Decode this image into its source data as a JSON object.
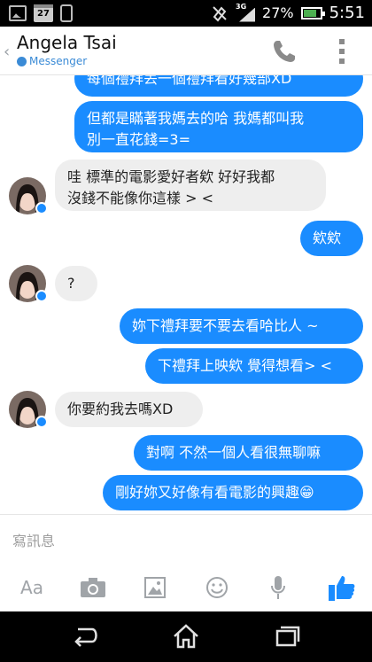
{
  "status_bar": {
    "calendar_day": "27",
    "network": "3G",
    "battery_percent": "27%",
    "time": "5:51"
  },
  "header": {
    "contact_name": "Angela Tsai",
    "subtitle": "Messenger"
  },
  "messages": [
    {
      "side": "out",
      "text": "每個禮拜丟一個禮拜看好幾部XD"
    },
    {
      "side": "out",
      "text": "但都是瞞著我媽去的哈 我媽都叫我\n別一直花錢=3="
    },
    {
      "side": "in",
      "text": "哇 標準的電影愛好者欸 好好我都\n沒錢不能像你這樣 > <"
    },
    {
      "side": "out",
      "text": "欸欸"
    },
    {
      "side": "in",
      "text": "?"
    },
    {
      "side": "out",
      "text": "妳下禮拜要不要去看哈比人 ~"
    },
    {
      "side": "out",
      "text": "下禮拜上映欸 覺得想看> <"
    },
    {
      "side": "in",
      "text": "你要約我去嗎XD"
    },
    {
      "side": "out",
      "text": "對啊 不然一個人看很無聊嘛"
    },
    {
      "side": "out",
      "text": "剛好妳又好像有看電影的興趣😁"
    }
  ],
  "composer": {
    "placeholder": "寫訊息",
    "text_tool_label": "Aa"
  },
  "icons": {
    "phone": "phone-icon",
    "more": "more-vertical-icon",
    "camera": "camera-icon",
    "gallery": "gallery-icon",
    "emoji": "emoji-icon",
    "mic": "microphone-icon",
    "like": "thumbs-up-icon",
    "back": "back-nav-icon",
    "home": "home-nav-icon",
    "recents": "recents-nav-icon"
  },
  "colors": {
    "outgoing_bubble": "#1a8cff",
    "incoming_bubble": "#eeeeee",
    "accent": "#3b8bd6",
    "like_button": "#1a8cff"
  }
}
